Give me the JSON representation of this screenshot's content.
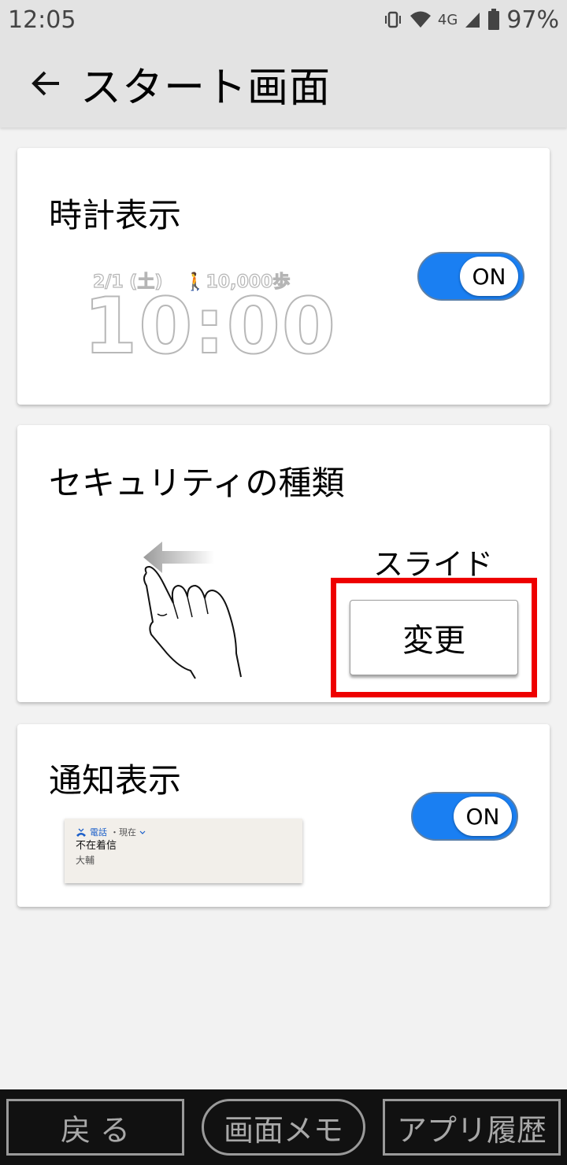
{
  "status_bar": {
    "time": "12:05",
    "network": "4G",
    "battery": "97%",
    "icons": [
      "vibrate-icon",
      "wifi-icon",
      "signal-icon",
      "battery-icon"
    ]
  },
  "app_bar": {
    "title": "スタート画面",
    "back_icon": "back-arrow-icon"
  },
  "clock_card": {
    "title": "時計表示",
    "preview_date": "2/1 (土)",
    "preview_steps": "🚶10,000歩",
    "preview_time": "10:00",
    "toggle_label": "ON"
  },
  "security_card": {
    "title": "セキュリティの種類",
    "current_value": "スライド",
    "change_button": "変更",
    "illustration": "swipe-left-hand-icon"
  },
  "notification_card": {
    "title": "通知表示",
    "toggle_label": "ON",
    "preview": {
      "app": "電話",
      "time": "・現在",
      "title": "不在着信",
      "body": "大輔"
    }
  },
  "bottom_nav": {
    "back": "戻 る",
    "memo": "画面メモ",
    "history": "アプリ履歴"
  },
  "colors": {
    "toggle_on": "#1a7ff2",
    "highlight": "#ee0000",
    "app_bar": "#e3e3e3"
  }
}
